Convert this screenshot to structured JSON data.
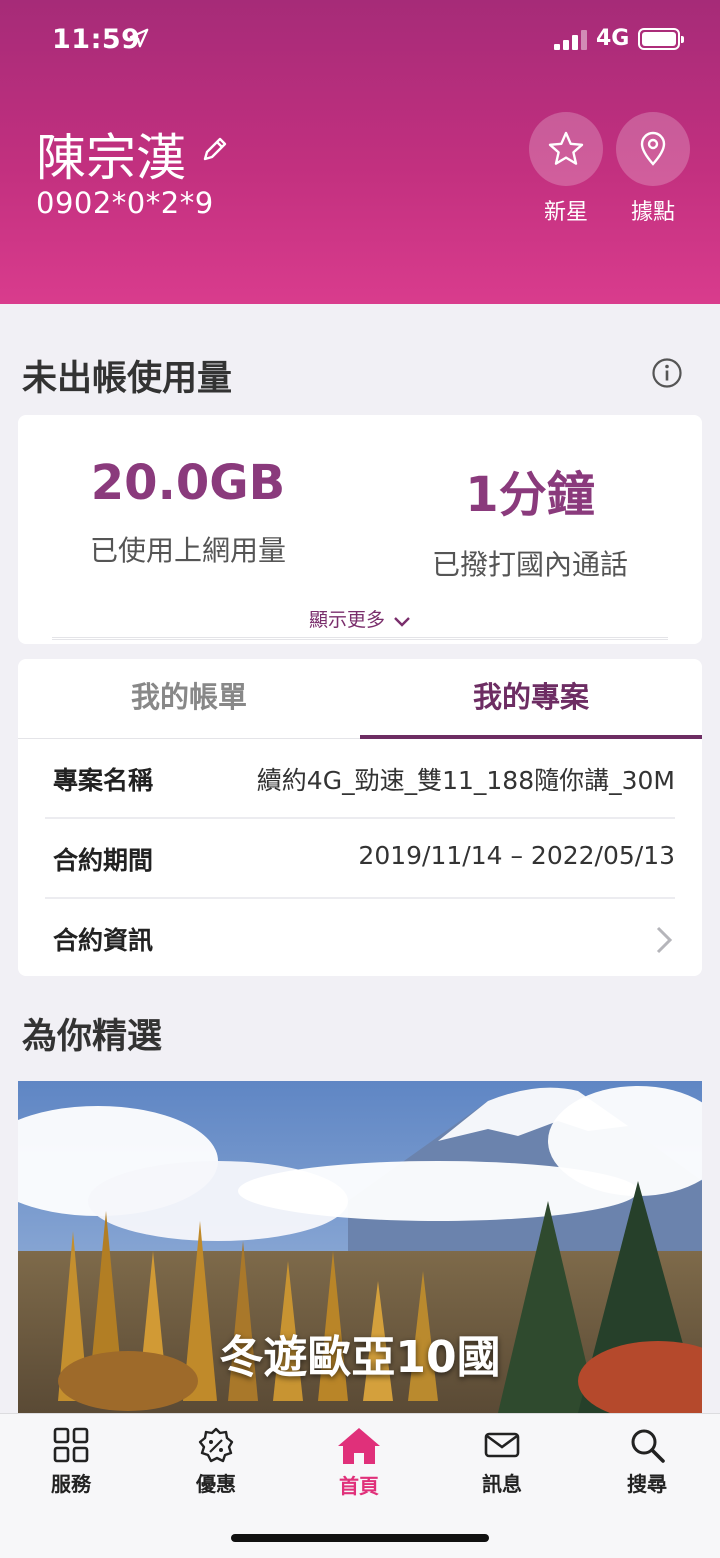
{
  "status_bar": {
    "time": "11:59",
    "network": "4G"
  },
  "header": {
    "user_name": "陳宗漢",
    "phone": "0902*0*2*9",
    "buttons": [
      {
        "label": "新星",
        "icon": "star-icon"
      },
      {
        "label": "據點",
        "icon": "location-pin-icon"
      }
    ]
  },
  "usage": {
    "title": "未出帳使用量",
    "data_value": "20.0GB",
    "data_desc": "已使用上網用量",
    "voice_value": "1分鐘",
    "voice_desc": "已撥打國內通話",
    "show_more": "顯示更多"
  },
  "plan": {
    "tabs": [
      "我的帳單",
      "我的專案"
    ],
    "active_tab": 1,
    "rows": [
      {
        "key": "專案名稱",
        "value": "續約4G_勁速_雙11_188隨你講_30M"
      },
      {
        "key": "合約期間",
        "value": "2019/11/14 – 2022/05/13"
      },
      {
        "key": "合約資訊",
        "value": ""
      }
    ]
  },
  "featured": {
    "title": "為你精選",
    "banner_text": "冬遊歐亞10國"
  },
  "bottom_nav": [
    {
      "label": "服務",
      "icon": "grid-icon"
    },
    {
      "label": "優惠",
      "icon": "coupon-icon"
    },
    {
      "label": "首頁",
      "icon": "home-icon",
      "active": true
    },
    {
      "label": "訊息",
      "icon": "mail-icon"
    },
    {
      "label": "搜尋",
      "icon": "search-icon"
    }
  ],
  "colors": {
    "header_top": "#a62b78",
    "header_bottom": "#d93c8d",
    "accent_purple": "#8a3a7c",
    "active_nav": "#e0307a"
  }
}
